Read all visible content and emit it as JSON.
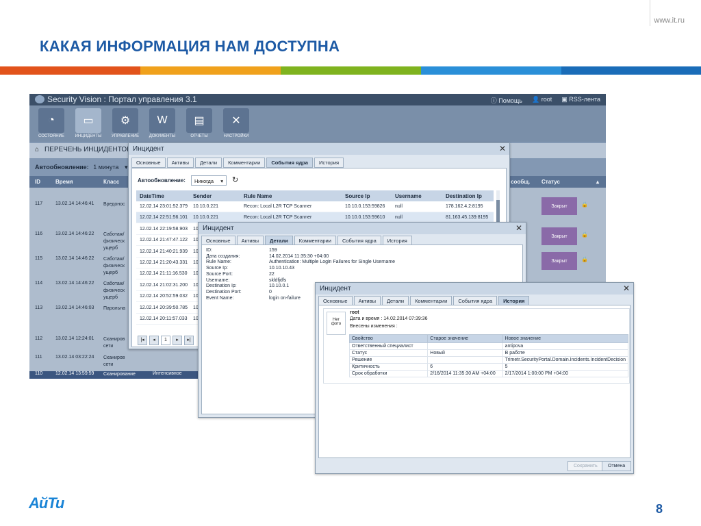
{
  "slide": {
    "site": "www.it.ru",
    "title": "КАКАЯ ИНФОРМАЦИЯ НАМ ДОСТУПНА",
    "stripes": [
      "#e2531b",
      "#f0a11c",
      "#7fb31f",
      "#2a8fd8",
      "#1a6cb8"
    ],
    "logo": "АйТи",
    "page": "8"
  },
  "app": {
    "title": "Security Vision : Портал управления 3.1",
    "links": {
      "help": "Помощь",
      "user": "root",
      "rss": "RSS-лента"
    },
    "toolbar": [
      {
        "label": "СОСТОЯНИЕ",
        "icon": "gauge-icon",
        "glyph": "◔"
      },
      {
        "label": "ИНЦИДЕНТЫ",
        "icon": "monitor-icon",
        "glyph": "▭"
      },
      {
        "label": "УПРАВЛЕНИЕ",
        "icon": "gears-icon",
        "glyph": "⚙"
      },
      {
        "label": "ДОКУМЕНТЫ",
        "icon": "word-icon",
        "glyph": "W"
      },
      {
        "label": "ОТЧЕТЫ",
        "icon": "report-icon",
        "glyph": "▤"
      },
      {
        "label": "НАСТРОЙКИ",
        "icon": "tools-icon",
        "glyph": "✕"
      }
    ],
    "list_title": "ПЕРЕЧЕНЬ ИНЦИДЕНТОВ",
    "auto_label": "Автообновление:",
    "auto_value": "1 минута",
    "columns": [
      "ID",
      "Время",
      "Класс",
      "о сообщ.",
      "Статус"
    ],
    "rows": [
      {
        "id": "117",
        "time": "13.02.14 14:46:41",
        "cls": "Вредонос",
        "status": "Закрыт"
      },
      {
        "id": "116",
        "time": "13.02.14 14:46:22",
        "cls": "Саботаж/ физическ ущерб",
        "status": "Закрыт"
      },
      {
        "id": "115",
        "time": "13.02.14 14:46:22",
        "cls": "Саботаж/ физическ ущерб",
        "status": "Закрыт"
      },
      {
        "id": "114",
        "time": "13.02.14 14:46:22",
        "cls": "Саботаж/ физическ ущерб",
        "status": ""
      },
      {
        "id": "113",
        "time": "13.02.14 14:46:03",
        "cls": "Парольна",
        "status": ""
      },
      {
        "id": "112",
        "time": "13.02.14 12:24:01",
        "cls": "Сканиров сети",
        "status": ""
      },
      {
        "id": "111",
        "time": "13.02.14 03:22:24",
        "cls": "Сканиров сети",
        "status": ""
      },
      {
        "id": "110",
        "time": "12.02.14 13:59:59",
        "cls": "Сканирование",
        "extra": "Интенсивное",
        "status": ""
      }
    ]
  },
  "dialog1": {
    "title": "Инцидент",
    "tabs": [
      "Основные",
      "Активы",
      "Детали",
      "Комментарии",
      "События ядра",
      "История"
    ],
    "active_tab": "События ядра",
    "auto_label": "Автообновление:",
    "auto_value": "Никогда",
    "columns": [
      "DateTime",
      "Sender",
      "Rule Name",
      "Source Ip",
      "Username",
      "Destination Ip"
    ],
    "rows": [
      [
        "12.02.14 23:01:52.379",
        "10.10.0.221",
        "Recon: Local L2R TCP Scanner",
        "10.10.0.153:59826",
        "null",
        "178.162.4.2:8195"
      ],
      [
        "12.02.14 22:51:56.101",
        "10.10.0.221",
        "Recon: Local L2R TCP Scanner",
        "10.10.0.153:59610",
        "null",
        "81.163.45.139:8195"
      ],
      [
        "12.02.14 22:19:58.903",
        "10.1",
        "",
        "",
        "",
        ""
      ],
      [
        "12.02.14 21:47:47.122",
        "10.1",
        "",
        "",
        "",
        ""
      ],
      [
        "12.02.14 21:40:21.939",
        "10.1",
        "",
        "",
        "",
        ""
      ],
      [
        "12.02.14 21:20:43.331",
        "10.1",
        "",
        "",
        "",
        ""
      ],
      [
        "12.02.14 21:11:16.530",
        "10.1",
        "",
        "",
        "",
        ""
      ],
      [
        "12.02.14 21:02:31.200",
        "10.1",
        "",
        "",
        "",
        ""
      ],
      [
        "12.02.14 20:52:59.032",
        "10.1",
        "",
        "",
        "",
        ""
      ],
      [
        "12.02.14 20:39:50.785",
        "10.1",
        "",
        "",
        "",
        ""
      ],
      [
        "12.02.14 20:11:57.033",
        "10.1",
        "",
        "",
        "",
        ""
      ]
    ],
    "pager": [
      "|◂",
      "◂",
      "1",
      "▸",
      "▸|"
    ]
  },
  "dialog2": {
    "title": "Инцидент",
    "tabs": [
      "Основные",
      "Активы",
      "Детали",
      "Комментарии",
      "События ядра",
      "История"
    ],
    "active_tab": "Детали",
    "fields": [
      {
        "k": "ID:",
        "v": "159"
      },
      {
        "k": "Дата создания:",
        "v": "14.02.2014 11:35:30 +04:00"
      },
      {
        "k": "Rule Name:",
        "v": "Authentication: Multiple Login Failures for Single Username"
      },
      {
        "k": "Source Ip:",
        "v": "10.10.10.43"
      },
      {
        "k": "Source Port:",
        "v": "22"
      },
      {
        "k": "Username:",
        "v": "skldfjdfs"
      },
      {
        "k": "Destination Ip:",
        "v": "10.10.0.1"
      },
      {
        "k": "Destination Port:",
        "v": "0"
      },
      {
        "k": "Event Name:",
        "v": "login on-failure"
      }
    ]
  },
  "dialog3": {
    "title": "Инцидент",
    "tabs": [
      "Основные",
      "Активы",
      "Детали",
      "Комментарии",
      "События ядра",
      "История"
    ],
    "active_tab": "История",
    "photo": "Нет фото",
    "user": "root",
    "date": "Дата и время : 14.02.2014 07:39:36",
    "changes_label": "Внесены изменения :",
    "columns": [
      "Свойство",
      "Старое значение",
      "Новое значение"
    ],
    "rows": [
      [
        "Ответственный специалист",
        "",
        "antipova"
      ],
      [
        "Статус",
        "Новый",
        "В работе"
      ],
      [
        "Решение",
        "",
        "Trimetr.SecurityPortal.Domain.Incidents.IncidentDecision"
      ],
      [
        "Критичность",
        "6",
        "5"
      ],
      [
        "Срок обработки",
        "2/16/2014 11:35:30 AM +04:00",
        "2/17/2014 1:00:00 PM +04:00"
      ]
    ],
    "save": "Сохранить",
    "cancel": "Отмена"
  }
}
